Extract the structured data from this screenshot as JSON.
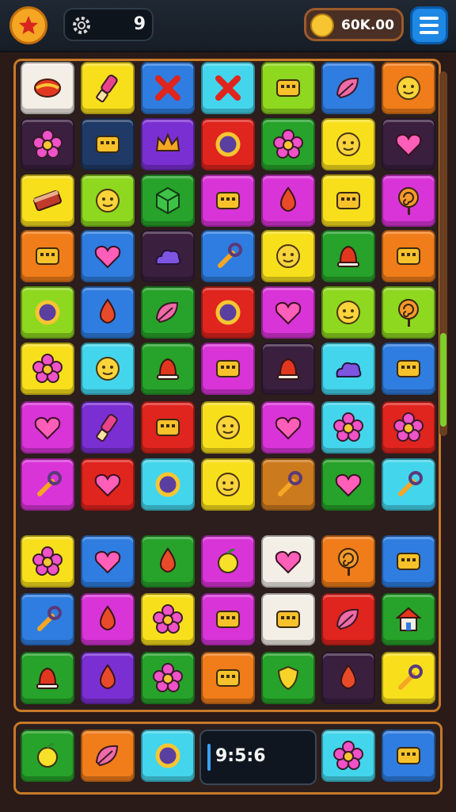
{
  "header": {
    "level": "9",
    "coins": "60K.00"
  },
  "colors": {
    "yellow": "#f8df1c",
    "blue": "#2f7de0",
    "green": "#27a22a",
    "cyan": "#43d5ec",
    "lime": "#8ed81f",
    "orange": "#f07d1a",
    "purple": "#7a2fd3",
    "magenta": "#d934d8",
    "red": "#e0241e",
    "white": "#f3eee6",
    "dark": "#3a1f3f",
    "navy": "#1f3a66",
    "brown": "#cc7a1e"
  },
  "board": {
    "rows": [
      [
        {
          "c": "white",
          "i": "candy"
        },
        {
          "c": "yellow",
          "i": "brush"
        },
        {
          "c": "blue",
          "i": "x"
        },
        {
          "c": "cyan",
          "i": "x"
        },
        {
          "c": "lime",
          "i": "box"
        },
        {
          "c": "blue",
          "i": "leaf"
        },
        {
          "c": "orange",
          "i": "face"
        }
      ],
      [
        {
          "c": "dark",
          "i": "flower"
        },
        {
          "c": "navy",
          "i": "box"
        },
        {
          "c": "purple",
          "i": "crown"
        },
        {
          "c": "red",
          "i": "ring"
        },
        {
          "c": "green",
          "i": "flower"
        },
        {
          "c": "yellow",
          "i": "face"
        },
        {
          "c": "dark",
          "i": "heart"
        }
      ],
      [
        {
          "c": "yellow",
          "i": "bar"
        },
        {
          "c": "lime",
          "i": "face"
        },
        {
          "c": "green",
          "i": "cube"
        },
        {
          "c": "magenta",
          "i": "box"
        },
        {
          "c": "magenta",
          "i": "drop"
        },
        {
          "c": "yellow",
          "i": "box"
        },
        {
          "c": "magenta",
          "i": "swirl"
        }
      ],
      [
        {
          "c": "orange",
          "i": "box"
        },
        {
          "c": "blue",
          "i": "heart"
        },
        {
          "c": "dark",
          "i": "cloud"
        },
        {
          "c": "blue",
          "i": "wrench"
        },
        {
          "c": "yellow",
          "i": "face"
        },
        {
          "c": "green",
          "i": "bell"
        },
        {
          "c": "orange",
          "i": "box"
        }
      ],
      [
        {
          "c": "lime",
          "i": "ring"
        },
        {
          "c": "blue",
          "i": "drop"
        },
        {
          "c": "green",
          "i": "leaf"
        },
        {
          "c": "red",
          "i": "ring"
        },
        {
          "c": "magenta",
          "i": "heart"
        },
        {
          "c": "lime",
          "i": "face"
        },
        {
          "c": "lime",
          "i": "swirl"
        }
      ],
      [
        {
          "c": "yellow",
          "i": "flower"
        },
        {
          "c": "cyan",
          "i": "face"
        },
        {
          "c": "green",
          "i": "bell"
        },
        {
          "c": "magenta",
          "i": "box"
        },
        {
          "c": "dark",
          "i": "bell"
        },
        {
          "c": "cyan",
          "i": "cloud"
        },
        {
          "c": "blue",
          "i": "box"
        }
      ],
      [
        {
          "c": "magenta",
          "i": "heart"
        },
        {
          "c": "purple",
          "i": "brush"
        },
        {
          "c": "red",
          "i": "box"
        },
        {
          "c": "yellow",
          "i": "face"
        },
        {
          "c": "magenta",
          "i": "heart"
        },
        {
          "c": "cyan",
          "i": "flower"
        },
        {
          "c": "red",
          "i": "flower"
        }
      ],
      [
        {
          "c": "magenta",
          "i": "wrench"
        },
        {
          "c": "red",
          "i": "heart"
        },
        {
          "c": "cyan",
          "i": "ring"
        },
        {
          "c": "yellow",
          "i": "face"
        },
        {
          "c": "brown",
          "i": "wrench"
        },
        {
          "c": "green",
          "i": "heart"
        },
        {
          "c": "cyan",
          "i": "wrench"
        }
      ],
      [
        {
          "c": "yellow",
          "i": "flower"
        },
        {
          "c": "blue",
          "i": "heart"
        },
        {
          "c": "green",
          "i": "drop"
        },
        {
          "c": "magenta",
          "i": "apple"
        },
        {
          "c": "white",
          "i": "heart"
        },
        {
          "c": "orange",
          "i": "swirl"
        },
        {
          "c": "blue",
          "i": "box"
        }
      ],
      [
        {
          "c": "blue",
          "i": "wrench"
        },
        {
          "c": "magenta",
          "i": "drop"
        },
        {
          "c": "yellow",
          "i": "flower"
        },
        {
          "c": "magenta",
          "i": "box"
        },
        {
          "c": "white",
          "i": "box"
        },
        {
          "c": "red",
          "i": "leaf"
        },
        {
          "c": "green",
          "i": "house"
        }
      ],
      [
        {
          "c": "green",
          "i": "bell"
        },
        {
          "c": "purple",
          "i": "drop"
        },
        {
          "c": "green",
          "i": "flower"
        },
        {
          "c": "orange",
          "i": "box"
        },
        {
          "c": "green",
          "i": "shield"
        },
        {
          "c": "dark",
          "i": "drop"
        },
        {
          "c": "yellow",
          "i": "wrench"
        }
      ]
    ]
  },
  "dock": {
    "timer": "9:5:6",
    "tiles": [
      {
        "c": "green",
        "i": "apple"
      },
      {
        "c": "orange",
        "i": "leaf"
      },
      {
        "c": "cyan",
        "i": "ring"
      },
      {
        "c": "cyan",
        "i": "flower"
      },
      {
        "c": "blue",
        "i": "box"
      }
    ]
  }
}
